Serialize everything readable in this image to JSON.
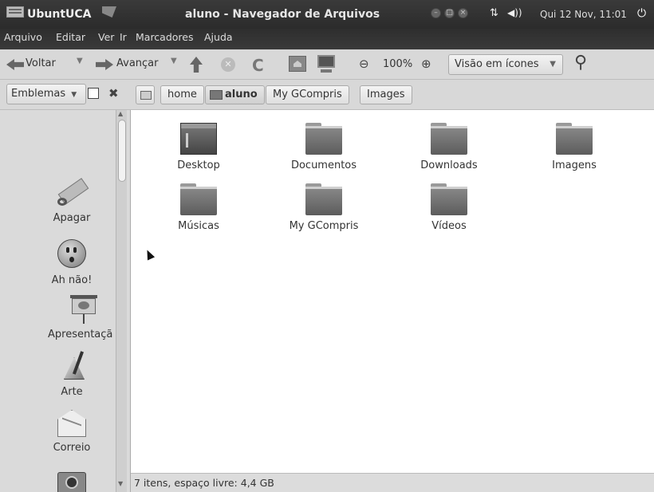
{
  "panel": {
    "app_name": "UbuntUCA",
    "window_title": "aluno - Navegador de Arquivos",
    "clock": "Qui 12 Nov, 11:01"
  },
  "menu": [
    "Arquivo",
    "Editar",
    "Ver",
    "Ir",
    "Marcadores",
    "Ajuda"
  ],
  "toolbar": {
    "back_label": "Voltar",
    "forward_label": "Avançar",
    "zoom_level": "100%",
    "view_mode": "Visão em ícones"
  },
  "location": {
    "sidepane_mode": "Emblemas",
    "crumbs": [
      "home",
      "aluno",
      "My GCompris",
      "Images"
    ]
  },
  "emblems": [
    {
      "label": "Apagar",
      "icon": "eraser-icon"
    },
    {
      "label": "Ah não!",
      "icon": "surprised-face-icon"
    },
    {
      "label": "Apresentaçã",
      "icon": "presentation-icon"
    },
    {
      "label": "Arte",
      "icon": "art-icon"
    },
    {
      "label": "Correio",
      "icon": "mail-icon"
    },
    {
      "label": "",
      "icon": "camera-icon"
    }
  ],
  "files": [
    {
      "name": "Desktop",
      "icon": "desktop-folder-icon"
    },
    {
      "name": "Documentos",
      "icon": "folder-icon"
    },
    {
      "name": "Downloads",
      "icon": "folder-icon"
    },
    {
      "name": "Imagens",
      "icon": "folder-icon"
    },
    {
      "name": "Músicas",
      "icon": "folder-icon"
    },
    {
      "name": "My GCompris",
      "icon": "folder-icon"
    },
    {
      "name": "Vídeos",
      "icon": "folder-icon"
    }
  ],
  "status": "7 itens, espaço livre: 4,4 GB"
}
